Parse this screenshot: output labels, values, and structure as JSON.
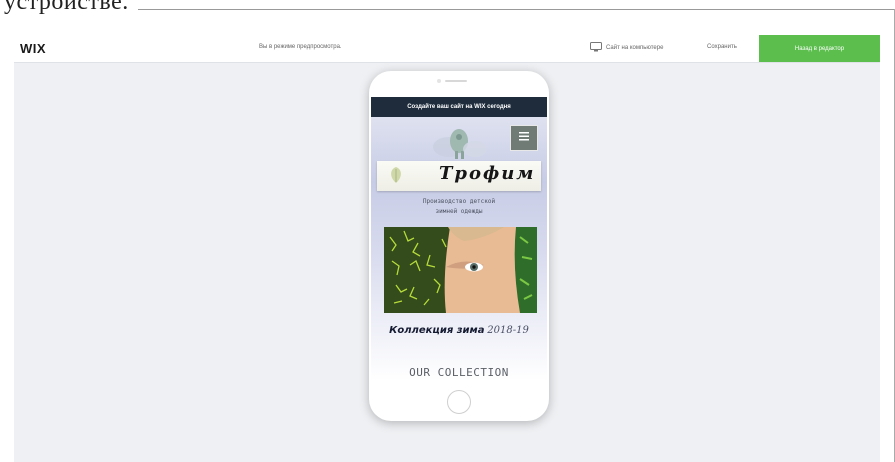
{
  "document": {
    "fragment_text": "устройстве."
  },
  "wix": {
    "logo": "WIX",
    "preview_mode_text": "Вы в режиме предпросмотра.",
    "desktop_view_label": "Сайт на компьютере",
    "save_label": "Сохранить",
    "editor_button_label": "Назад в редактор",
    "accent_color": "#5bbe4d"
  },
  "mobile_site": {
    "promo_banner": "Создайте ваш сайт на WIX сегодня",
    "brand_name": "Трофим",
    "tagline_line1": "Производство детской",
    "tagline_line2": "зимней одежды",
    "collection_bold": "Коллекция зима",
    "collection_year": "2018-19",
    "our_collection": "OUR COLLECTION"
  },
  "icons": [
    "monitor-icon",
    "hamburger-menu-icon",
    "leaf-icon",
    "elephant-icon"
  ]
}
